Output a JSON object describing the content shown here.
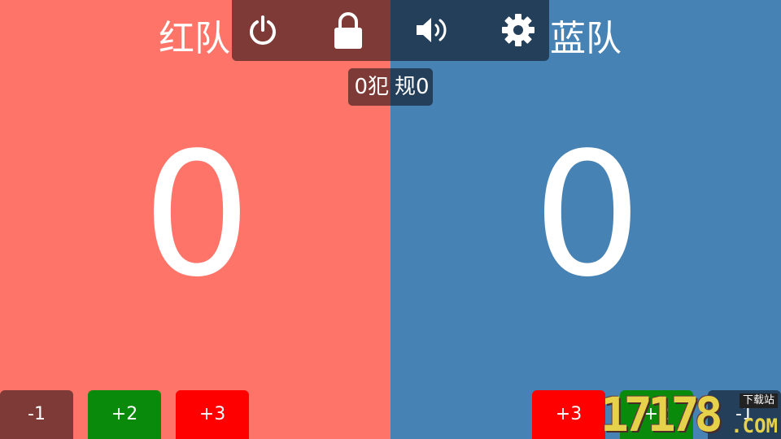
{
  "red_team": {
    "name": "红队",
    "score": "0",
    "fouls": "0犯",
    "buttons": {
      "minus1": "-1",
      "plus2": "+2",
      "plus3": "+3"
    }
  },
  "blue_team": {
    "name": "蓝队",
    "score": "0",
    "fouls": "规0",
    "buttons": {
      "minus1": "-1",
      "plus2": "+2",
      "plus3": "+3"
    }
  },
  "toolbar": {
    "icons": [
      "power-icon",
      "lock-icon",
      "volume-icon",
      "gear-icon"
    ]
  },
  "watermark": {
    "number": "17178",
    "tag": "下载站",
    "domain": ".COM"
  },
  "colors": {
    "red_bg": "#ff7468",
    "blue_bg": "#4682b4",
    "green_button": "#0a8a0a",
    "bright_red_button": "#ff0000"
  }
}
